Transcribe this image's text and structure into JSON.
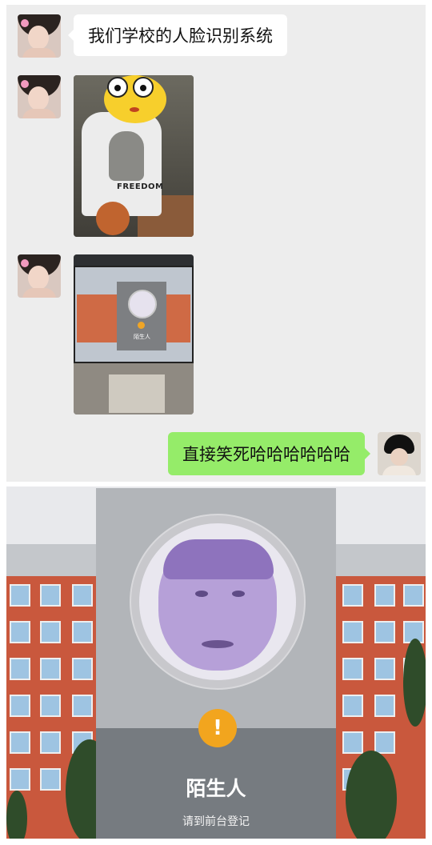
{
  "chat": {
    "messages": [
      {
        "side": "left",
        "type": "text",
        "text": "我们学校的人脸识别系统"
      },
      {
        "side": "left",
        "type": "image",
        "alt_icon": "photo-person-basketball"
      },
      {
        "side": "left",
        "type": "image",
        "alt_icon": "photo-face-recognition-screen"
      },
      {
        "side": "right",
        "type": "text",
        "text": "直接笑死哈哈哈哈哈哈"
      }
    ],
    "bubble_colors": {
      "left": "#ffffff",
      "right": "#95ec69"
    },
    "background": "#ededed"
  },
  "photo1": {
    "shirt_text": "FREEDOM"
  },
  "photo2": {
    "screen_label": "陌生人"
  },
  "big_photo": {
    "status_label": "陌生人",
    "sub_label": "请到前台登记",
    "warning_symbol": "!"
  },
  "colors": {
    "warning": "#f2a51e",
    "building": "#c9583d",
    "panel": "#b2b5b9"
  }
}
